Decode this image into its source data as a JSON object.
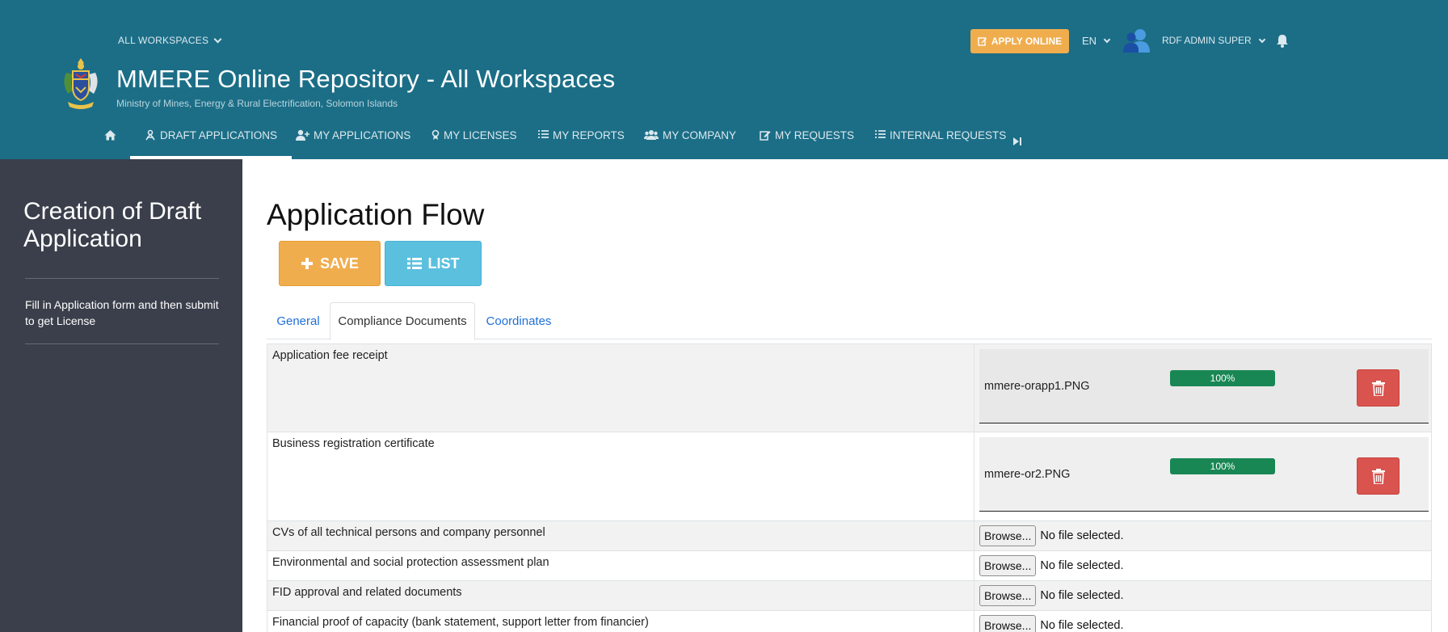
{
  "header": {
    "workspace_selector": "ALL WORKSPACES",
    "site_title": "MMERE Online Repository - All Workspaces",
    "site_subtitle": "Ministry of Mines, Energy & Rural Electrification, Solomon Islands",
    "apply_online": "APPLY ONLINE",
    "language": "EN",
    "user_name": "RDF ADMIN SUPER",
    "icons": [
      "coat-of-arms-logo",
      "edit-icon",
      "user-avatar-icon",
      "bell-icon"
    ],
    "colors": {
      "header_bg": "#1c6e87",
      "accent_orange": "#f0ad4e"
    }
  },
  "nav": {
    "home_icon": "home-icon",
    "items": [
      {
        "label": "DRAFT APPLICATIONS",
        "icon": "draft-icon",
        "active": true
      },
      {
        "label": "MY APPLICATIONS",
        "icon": "user-plus-icon"
      },
      {
        "label": "MY LICENSES",
        "icon": "license-icon"
      },
      {
        "label": "MY REPORTS",
        "icon": "list-icon"
      },
      {
        "label": "MY COMPANY",
        "icon": "users-icon"
      },
      {
        "label": "MY REQUESTS",
        "icon": "edit-icon"
      },
      {
        "label": "INTERNAL REQUESTS",
        "icon": "list-icon"
      }
    ],
    "more_icon": "step-forward-icon"
  },
  "sidebar": {
    "title": "Creation of Draft Application",
    "description": "Fill in Application form and then submit to get License",
    "colors": {
      "bg": "#3a3f4b"
    }
  },
  "main": {
    "page_title": "Application Flow",
    "save_label": "SAVE",
    "list_label": "LIST",
    "tabs": [
      {
        "label": "General",
        "active": false
      },
      {
        "label": "Compliance Documents",
        "active": true
      },
      {
        "label": "Coordinates",
        "active": false
      }
    ],
    "documents": [
      {
        "label": "Application fee receipt",
        "file": "mmere-orapp1.PNG",
        "progress_pct": 100,
        "progress_text": "100%"
      },
      {
        "label": "Business registration certificate",
        "file": "mmere-or2.PNG",
        "progress_pct": 100,
        "progress_text": "100%"
      },
      {
        "label": "CVs of all technical persons and company personnel",
        "browse": "Browse...",
        "status": "No file selected."
      },
      {
        "label": "Environmental and social protection assessment plan",
        "browse": "Browse...",
        "status": "No file selected."
      },
      {
        "label": "FID approval and related documents",
        "browse": "Browse...",
        "status": "No file selected."
      },
      {
        "label": "Financial proof of capacity (bank statement, support letter from financier)",
        "browse": "Browse...",
        "status": "No file selected."
      }
    ],
    "colors": {
      "save": "#f0ad4e",
      "list": "#5bc0de",
      "progress": "#198754",
      "delete": "#d9534f"
    }
  }
}
